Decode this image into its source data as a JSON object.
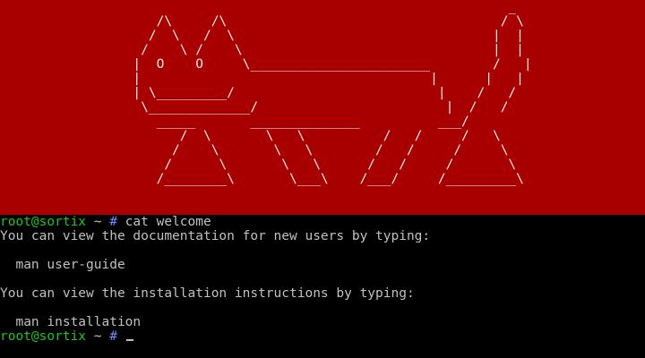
{
  "banner": {
    "background": "#a80000",
    "ascii_art": "                                                                 _\n                    /\\     /\\                                   / \\\n                   /  \\   /  \\                                 |  |\n                  /    \\ /    \\                                |  |\n                 |  O    O     \\_______________________        /   |\n                 |                                     |      |   |\n                 | \\_________/                          |    /   /\n                  \\_____________/                        |  /   /\n                    _____       ______________          ___/\n                       /  \\       \\   \\          /   /     /   \\\n                      /    \\       \\   \\        /   /     /     \\\n                     /      \\       \\   \\      /   /     /       \\\n                    /________\\       \\___\\    /___/     /_________\\"
  },
  "terminal": {
    "prompt_user": "root@sortix",
    "prompt_path": " ~ ",
    "prompt_symbol": "#",
    "command": "cat welcome",
    "output": [
      "You can view the documentation for new users by typing:",
      "",
      "  man user-guide",
      "",
      "You can view the installation instructions by typing:",
      "",
      "  man installation"
    ],
    "second_prompt_user": "root@sortix",
    "second_prompt_path": " ~ ",
    "second_prompt_symbol": "#"
  }
}
